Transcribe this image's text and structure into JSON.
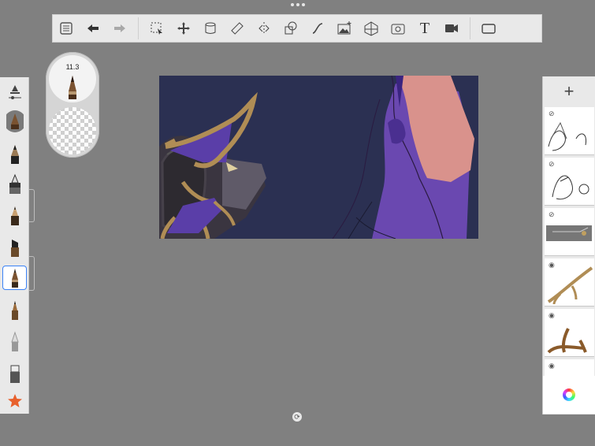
{
  "app": {
    "name": "Sketchbook canvas"
  },
  "toolbar": {
    "items": [
      {
        "name": "layers-list-icon"
      },
      {
        "name": "undo-icon"
      },
      {
        "name": "redo-icon"
      },
      {
        "name": "selection-icon"
      },
      {
        "name": "transform-icon"
      },
      {
        "name": "fill-icon"
      },
      {
        "name": "ruler-icon"
      },
      {
        "name": "symmetry-icon"
      },
      {
        "name": "shapes-icon"
      },
      {
        "name": "curve-icon"
      },
      {
        "name": "image-icon"
      },
      {
        "name": "perspective-icon"
      },
      {
        "name": "time-lapse-icon"
      },
      {
        "name": "text-icon"
      },
      {
        "name": "record-icon"
      },
      {
        "name": "fullscreen-icon"
      }
    ],
    "text_tool_glyph": "T"
  },
  "brush_puck": {
    "size_label": "11.3"
  },
  "left_tools": [
    {
      "name": "brush-settings-icon"
    },
    {
      "name": "current-brush-icon"
    },
    {
      "name": "pencil-brush-icon"
    },
    {
      "name": "airbrush-icon"
    },
    {
      "name": "ink-pen-icon"
    },
    {
      "name": "chisel-marker-icon"
    },
    {
      "name": "selected-brush-icon"
    },
    {
      "name": "paint-brush-icon"
    },
    {
      "name": "soft-pencil-icon"
    },
    {
      "name": "eraser-icon"
    },
    {
      "name": "favorites-star-icon"
    }
  ],
  "layers": [
    {
      "name": "layer-1",
      "visible": false
    },
    {
      "name": "layer-2",
      "visible": false
    },
    {
      "name": "layer-3",
      "visible": false
    },
    {
      "name": "layer-4",
      "visible": true
    },
    {
      "name": "layer-5",
      "visible": true
    },
    {
      "name": "layer-6",
      "visible": true
    }
  ],
  "layers_panel": {
    "add_label": "+"
  },
  "colors": {
    "canvas_bg": "#2b3052",
    "purple": "#6a48b0",
    "pink": "#d9928c",
    "gold": "#b08d55",
    "accent": "#3b82f6"
  }
}
